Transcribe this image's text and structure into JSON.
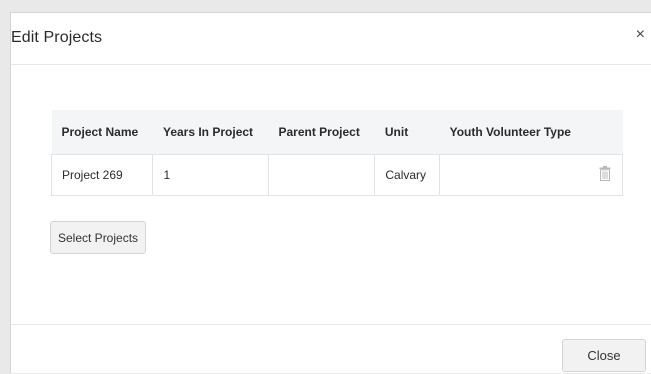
{
  "modal": {
    "title": "Edit Projects",
    "close_icon": "close-icon",
    "close_glyph": "×"
  },
  "table": {
    "columns": [
      "Project Name",
      "Years In Project",
      "Parent Project",
      "Unit",
      "Youth Volunteer Type"
    ],
    "rows": [
      {
        "project_name": "Project 269",
        "years_in_project": "1",
        "parent_project": "",
        "unit": "Calvary",
        "youth_volunteer_type": "",
        "action_icon": "trash-icon"
      }
    ]
  },
  "buttons": {
    "select_projects": "Select Projects",
    "close": "Close"
  },
  "colors": {
    "header_bg": "#f4f5f7",
    "button_bg": "#f2f2f2",
    "border": "#e3e3e3",
    "icon": "#b8b8b8"
  }
}
